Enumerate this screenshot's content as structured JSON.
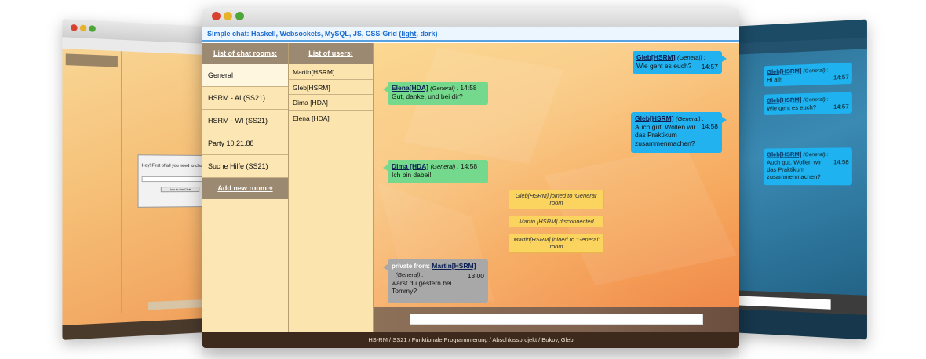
{
  "app": {
    "header_text": "Simple chat: Haskell, Websockets, MySQL, JS, CSS-Grid (",
    "header_light": "light",
    "header_sep": ", ",
    "header_dark": "dark",
    "header_close": ")"
  },
  "colors": {
    "dot_red": "#d9412f",
    "dot_yellow": "#e7b22a",
    "dot_green": "#4ea538",
    "bubble_blue": "#22b2f0",
    "bubble_green": "#74d98c",
    "bubble_gray": "#a8a8a8",
    "system_note": "#fbd35f"
  },
  "rooms": {
    "heading": "List of chat rooms:",
    "items": [
      {
        "label": "General"
      },
      {
        "label": "HSRM - AI (SS21)"
      },
      {
        "label": "HSRM - WI (SS21)"
      },
      {
        "label": "Party 10.21.88"
      },
      {
        "label": "Suche Hilfe (SS21)"
      }
    ],
    "add_label": "Add new room +"
  },
  "users": {
    "heading": "List of users:",
    "items": [
      {
        "label": "Martin[HSRM]"
      },
      {
        "label": "Gleb[HSRM]"
      },
      {
        "label": "Dima [HDA]"
      },
      {
        "label": "Elena [HDA]"
      }
    ]
  },
  "messages": [
    {
      "user": "Gleb[HSRM]",
      "room": "(General) :",
      "time": "14:57",
      "text": "Wie geht es euch?"
    },
    {
      "user": "Elena[HDA]",
      "room": "(General) :",
      "time": "14:58",
      "text": "Gut, danke, und bei dir?"
    },
    {
      "user": "Gleb[HSRM]",
      "room": "(General) :",
      "time": "14:58",
      "text_1": "Auch gut. Wollen wir",
      "text_2": "das Praktikum",
      "text_3": "zusammenmachen?"
    },
    {
      "user": "Dima [HDA]",
      "room": "(General) :",
      "time": "14:58",
      "text": "Ich bin dabei!"
    },
    {
      "private_label": "private from:",
      "user": "Martin[HSRM]",
      "room": "(General) :",
      "time": "13:00",
      "text_1": "warst du gestern bei",
      "text_2": "Tommy?"
    }
  ],
  "system_notes": [
    {
      "line_1": "Gleb[HSRM] joined to 'General'",
      "line_2": "room"
    },
    {
      "line_1": "Martin [HSRM] disconnected"
    },
    {
      "line_1": "Martin[HSRM] joined to 'General'",
      "line_2": "room"
    }
  ],
  "composer": {
    "value": ""
  },
  "footer": "HS-RM / SS21 / Funktionale Programmierung / Abschlussprojekt / Bukov, Gleb",
  "left_window": {
    "dialog_text": "Hey! First of all you need to cho",
    "join_label": "Join to the Chat"
  },
  "right_window": {
    "messages": [
      {
        "user": "Gleb[HSRM]",
        "room": "(General) :",
        "time": "14:57",
        "text": "Hi all!"
      },
      {
        "user": "Gleb[HSRM]",
        "room": "(General) :",
        "time": "14:57",
        "text": "Wie geht es euch?"
      },
      {
        "user": "Gleb[HSRM]",
        "room": "(General) :",
        "time": "14:58",
        "text_1": "Auch gut. Wollen wir",
        "text_2": "das Praktikum",
        "text_3": "zusammenmachen?"
      }
    ]
  }
}
